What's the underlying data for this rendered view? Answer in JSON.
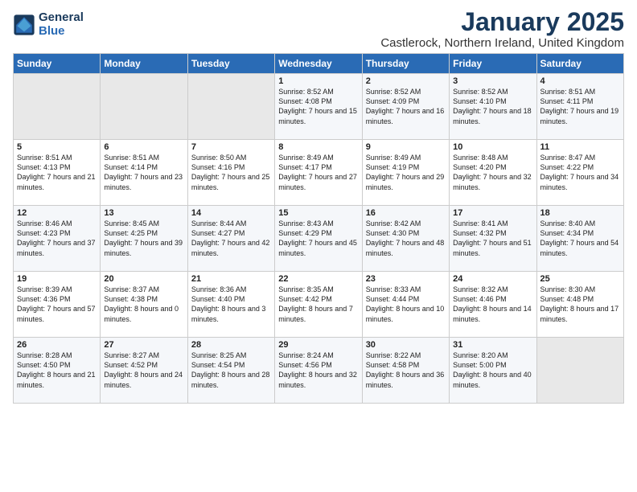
{
  "header": {
    "logo_line1": "General",
    "logo_line2": "Blue",
    "title": "January 2025",
    "location": "Castlerock, Northern Ireland, United Kingdom"
  },
  "days_of_week": [
    "Sunday",
    "Monday",
    "Tuesday",
    "Wednesday",
    "Thursday",
    "Friday",
    "Saturday"
  ],
  "weeks": [
    [
      {
        "day": "",
        "empty": true
      },
      {
        "day": "",
        "empty": true
      },
      {
        "day": "",
        "empty": true
      },
      {
        "day": "1",
        "sunrise": "8:52 AM",
        "sunset": "4:08 PM",
        "daylight": "7 hours and 15 minutes."
      },
      {
        "day": "2",
        "sunrise": "8:52 AM",
        "sunset": "4:09 PM",
        "daylight": "7 hours and 16 minutes."
      },
      {
        "day": "3",
        "sunrise": "8:52 AM",
        "sunset": "4:10 PM",
        "daylight": "7 hours and 18 minutes."
      },
      {
        "day": "4",
        "sunrise": "8:51 AM",
        "sunset": "4:11 PM",
        "daylight": "7 hours and 19 minutes."
      }
    ],
    [
      {
        "day": "5",
        "sunrise": "8:51 AM",
        "sunset": "4:13 PM",
        "daylight": "7 hours and 21 minutes."
      },
      {
        "day": "6",
        "sunrise": "8:51 AM",
        "sunset": "4:14 PM",
        "daylight": "7 hours and 23 minutes."
      },
      {
        "day": "7",
        "sunrise": "8:50 AM",
        "sunset": "4:16 PM",
        "daylight": "7 hours and 25 minutes."
      },
      {
        "day": "8",
        "sunrise": "8:49 AM",
        "sunset": "4:17 PM",
        "daylight": "7 hours and 27 minutes."
      },
      {
        "day": "9",
        "sunrise": "8:49 AM",
        "sunset": "4:19 PM",
        "daylight": "7 hours and 29 minutes."
      },
      {
        "day": "10",
        "sunrise": "8:48 AM",
        "sunset": "4:20 PM",
        "daylight": "7 hours and 32 minutes."
      },
      {
        "day": "11",
        "sunrise": "8:47 AM",
        "sunset": "4:22 PM",
        "daylight": "7 hours and 34 minutes."
      }
    ],
    [
      {
        "day": "12",
        "sunrise": "8:46 AM",
        "sunset": "4:23 PM",
        "daylight": "7 hours and 37 minutes."
      },
      {
        "day": "13",
        "sunrise": "8:45 AM",
        "sunset": "4:25 PM",
        "daylight": "7 hours and 39 minutes."
      },
      {
        "day": "14",
        "sunrise": "8:44 AM",
        "sunset": "4:27 PM",
        "daylight": "7 hours and 42 minutes."
      },
      {
        "day": "15",
        "sunrise": "8:43 AM",
        "sunset": "4:29 PM",
        "daylight": "7 hours and 45 minutes."
      },
      {
        "day": "16",
        "sunrise": "8:42 AM",
        "sunset": "4:30 PM",
        "daylight": "7 hours and 48 minutes."
      },
      {
        "day": "17",
        "sunrise": "8:41 AM",
        "sunset": "4:32 PM",
        "daylight": "7 hours and 51 minutes."
      },
      {
        "day": "18",
        "sunrise": "8:40 AM",
        "sunset": "4:34 PM",
        "daylight": "7 hours and 54 minutes."
      }
    ],
    [
      {
        "day": "19",
        "sunrise": "8:39 AM",
        "sunset": "4:36 PM",
        "daylight": "7 hours and 57 minutes."
      },
      {
        "day": "20",
        "sunrise": "8:37 AM",
        "sunset": "4:38 PM",
        "daylight": "8 hours and 0 minutes."
      },
      {
        "day": "21",
        "sunrise": "8:36 AM",
        "sunset": "4:40 PM",
        "daylight": "8 hours and 3 minutes."
      },
      {
        "day": "22",
        "sunrise": "8:35 AM",
        "sunset": "4:42 PM",
        "daylight": "8 hours and 7 minutes."
      },
      {
        "day": "23",
        "sunrise": "8:33 AM",
        "sunset": "4:44 PM",
        "daylight": "8 hours and 10 minutes."
      },
      {
        "day": "24",
        "sunrise": "8:32 AM",
        "sunset": "4:46 PM",
        "daylight": "8 hours and 14 minutes."
      },
      {
        "day": "25",
        "sunrise": "8:30 AM",
        "sunset": "4:48 PM",
        "daylight": "8 hours and 17 minutes."
      }
    ],
    [
      {
        "day": "26",
        "sunrise": "8:28 AM",
        "sunset": "4:50 PM",
        "daylight": "8 hours and 21 minutes."
      },
      {
        "day": "27",
        "sunrise": "8:27 AM",
        "sunset": "4:52 PM",
        "daylight": "8 hours and 24 minutes."
      },
      {
        "day": "28",
        "sunrise": "8:25 AM",
        "sunset": "4:54 PM",
        "daylight": "8 hours and 28 minutes."
      },
      {
        "day": "29",
        "sunrise": "8:24 AM",
        "sunset": "4:56 PM",
        "daylight": "8 hours and 32 minutes."
      },
      {
        "day": "30",
        "sunrise": "8:22 AM",
        "sunset": "4:58 PM",
        "daylight": "8 hours and 36 minutes."
      },
      {
        "day": "31",
        "sunrise": "8:20 AM",
        "sunset": "5:00 PM",
        "daylight": "8 hours and 40 minutes."
      },
      {
        "day": "",
        "empty": true
      }
    ]
  ]
}
